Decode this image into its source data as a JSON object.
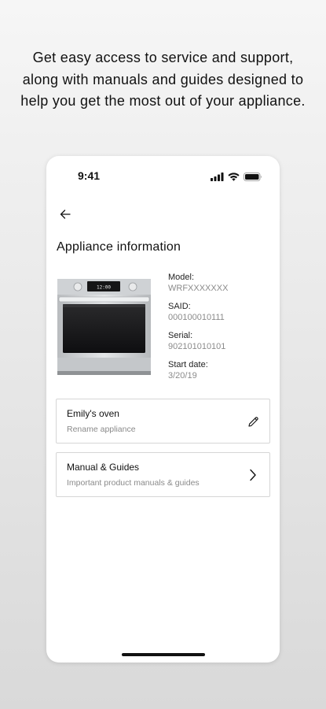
{
  "headline": "Get easy access to service and support, along with manuals and guides designed to help you get the most out of your appliance.",
  "status_bar": {
    "time": "9:41",
    "icons": [
      "cellular-signal-icon",
      "wifi-icon",
      "battery-icon"
    ]
  },
  "back_icon": "arrow-left-icon",
  "page_title": "Appliance information",
  "oven": {
    "display_time": "12:00"
  },
  "details": [
    {
      "label": "Model:",
      "value": "WRFXXXXXXX"
    },
    {
      "label": "SAID:",
      "value": "000100010111"
    },
    {
      "label": "Serial:",
      "value": "902101010101"
    },
    {
      "label": "Start date:",
      "value": "3/20/19"
    }
  ],
  "cards": [
    {
      "title": "Emily's oven",
      "subtitle": "Rename appliance",
      "icon": "pencil-icon"
    },
    {
      "title": "Manual & Guides",
      "subtitle": "Important product manuals & guides",
      "icon": "chevron-right-icon"
    }
  ],
  "colors": {
    "text": "#111111",
    "muted": "#8b8b8b",
    "card_border": "#d6d6d6"
  }
}
